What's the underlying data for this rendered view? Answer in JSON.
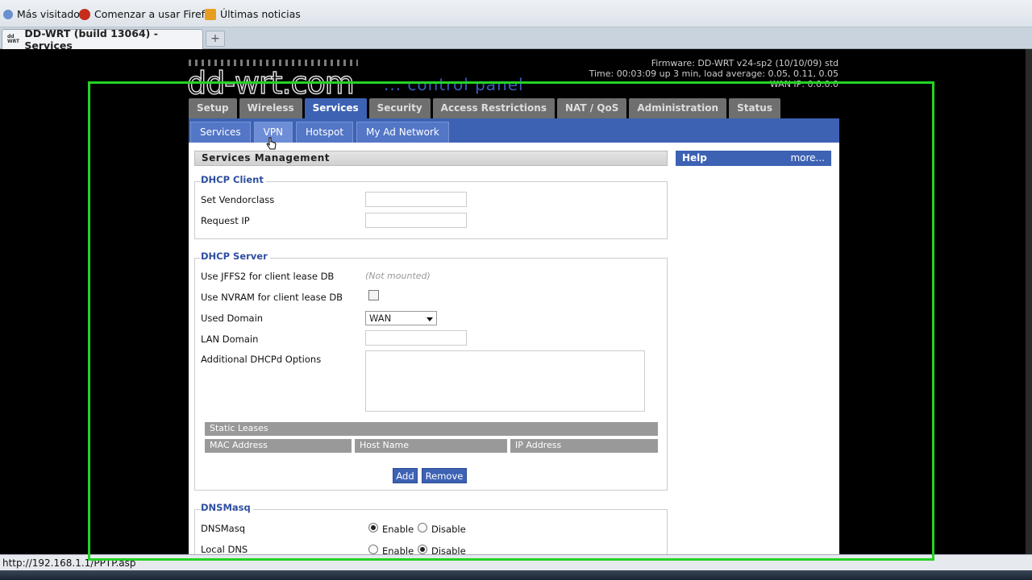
{
  "browser": {
    "bookmarks": [
      "Más visitados",
      "Comenzar a usar Firefox",
      "Últimas noticias"
    ],
    "tab_title": "DD-WRT (build 13064) - Services",
    "tab_favicon_text": "dd\nWRT",
    "new_tab": "+",
    "status_url": "http://192.168.1.1/PPTP.asp"
  },
  "header": {
    "logo": "dd-wrt.com",
    "logo_sub": "... control panel",
    "firmware": "Firmware: DD-WRT v24-sp2 (10/10/09) std",
    "time": "Time: 00:03:09 up 3 min, load average: 0.05, 0.11, 0.05",
    "wan_ip": "WAN IP: 0.0.0.0"
  },
  "main_tabs": [
    "Setup",
    "Wireless",
    "Services",
    "Security",
    "Access Restrictions",
    "NAT / QoS",
    "Administration",
    "Status"
  ],
  "main_tab_active": "Services",
  "sub_tabs": [
    "Services",
    "VPN",
    "Hotspot",
    "My Ad Network"
  ],
  "sub_tab_active": "VPN",
  "section_title": "Services Management",
  "help": {
    "title": "Help",
    "more": "more..."
  },
  "dhcp_client": {
    "legend": "DHCP Client",
    "vendorclass_label": "Set Vendorclass",
    "vendorclass_value": "",
    "request_ip_label": "Request IP",
    "request_ip_value": ""
  },
  "dhcp_server": {
    "legend": "DHCP Server",
    "jffs2_label": "Use JFFS2 for client lease DB",
    "jffs2_note": "(Not mounted)",
    "nvram_label": "Use NVRAM for client lease DB",
    "nvram_checked": false,
    "domain_label": "Used Domain",
    "domain_value": "WAN",
    "lan_domain_label": "LAN Domain",
    "lan_domain_value": "",
    "options_label": "Additional DHCPd Options",
    "options_value": "",
    "static_leases": "Static Leases",
    "columns": [
      "MAC Address",
      "Host Name",
      "IP Address"
    ],
    "add_button": "Add",
    "remove_button": "Remove"
  },
  "dnsmasq": {
    "legend": "DNSMasq",
    "dnsmasq_label": "DNSMasq",
    "dnsmasq_value": "Enable",
    "local_dns_label": "Local DNS",
    "local_dns_value": "Disable",
    "enable": "Enable",
    "disable": "Disable"
  }
}
